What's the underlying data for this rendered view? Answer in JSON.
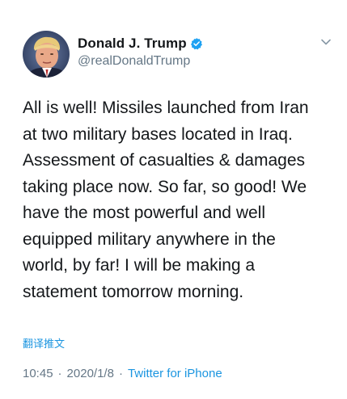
{
  "author": {
    "display_name": "Donald J. Trump",
    "handle": "@realDonaldTrump",
    "verified": true,
    "verified_color": "#1da1f2"
  },
  "icons": {
    "avatar": "profile-photo",
    "verified": "verified-badge-icon",
    "menu": "chevron-down-icon"
  },
  "tweet": {
    "text": "All is well! Missiles launched from Iran\nat two military bases located in Iraq.\nAssessment of casualties & damages\ntaking place now. So far, so good! We\nhave the most powerful and well\nequipped military anywhere in the\nworld, by far! I will be making a\nstatement tomorrow morning.",
    "translate_label": "翻译推文"
  },
  "meta": {
    "time": "10:45",
    "date": "2020/1/8",
    "separator": "·",
    "source": "Twitter for iPhone"
  },
  "colors": {
    "text": "#14171a",
    "secondary": "#657786",
    "link": "#1b95e0"
  }
}
